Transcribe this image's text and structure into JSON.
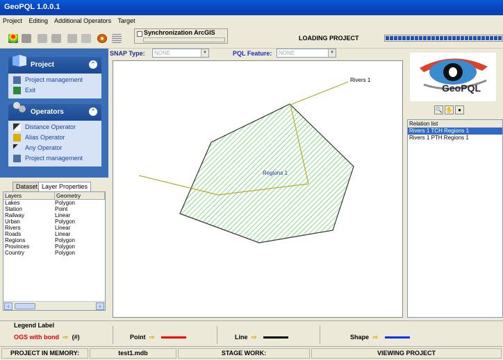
{
  "window": {
    "title": "GeoPQL 1.0.0.1"
  },
  "menu": [
    "Project",
    "Editing",
    "Additional Operators",
    "Target"
  ],
  "toolbar": {
    "sync_label": "Synchronization ArcGIS",
    "loading_label": "LOADING PROJECT",
    "icons": [
      "traffic-light-icon",
      "disk-icon",
      "edit-icon",
      "pen-icon",
      "pin-icon",
      "line-icon",
      "target-icon",
      "grid-icon"
    ]
  },
  "sidebar": {
    "project": {
      "title": "Project",
      "items": [
        {
          "label": "Project management",
          "icon": "project-icon"
        },
        {
          "label": "Exit",
          "icon": "exit-icon"
        }
      ]
    },
    "operators": {
      "title": "Operators",
      "items": [
        {
          "label": "Distance Operator",
          "icon": "distance-icon"
        },
        {
          "label": "Alias Operator",
          "icon": "alias-icon"
        },
        {
          "label": "Any Operator",
          "icon": "any-icon"
        },
        {
          "label": "Project management",
          "icon": "project-icon"
        }
      ]
    }
  },
  "tabs": [
    "Dataset",
    "Layer Properties"
  ],
  "layers": {
    "headers": [
      "Layers",
      "Geometry"
    ],
    "rows": [
      [
        "Lakes",
        "Polygon"
      ],
      [
        "Station",
        "Point"
      ],
      [
        "Railway",
        "Linear"
      ],
      [
        "Urban",
        "Polygon"
      ],
      [
        "Rivers",
        "Linear"
      ],
      [
        "Roads",
        "Linear"
      ],
      [
        "Regions",
        "Polygon"
      ],
      [
        "Provinces",
        "Polygon"
      ],
      [
        "Country",
        "Polygon"
      ]
    ]
  },
  "snap": {
    "label": "SNAP Type:",
    "value": "NONE"
  },
  "pql": {
    "label": "PQL Feature:",
    "value": "NONE"
  },
  "map": {
    "river_label": "Rivers 1",
    "region_label": "Regions 1",
    "colors": {
      "river": "#b8a830",
      "region_hatch": "#33cc33",
      "region_label": "#2233aa"
    }
  },
  "logo": {
    "text": "GeoPQL"
  },
  "relation_list": {
    "header": "Relation list",
    "items": [
      {
        "label": "Rivers 1 TCH Regions 1",
        "selected": true
      },
      {
        "label": "Rivers 1 PTH Regions 1",
        "selected": false
      }
    ]
  },
  "legend": {
    "title": "Legend Label",
    "ogs": "OGS with bond",
    "ogs_value": "(#)",
    "point": "Point",
    "line": "Line",
    "shape": "Shape",
    "colors": {
      "ogs": "#ee0000",
      "point": "#ff0000",
      "line": "#000000",
      "shape": "#0033ff"
    }
  },
  "status": {
    "memory_label": "PROJECT IN MEMORY:",
    "file": "test1.mdb",
    "stage_label": "STAGE WORK:",
    "stage_value": "VIEWING PROJECT"
  }
}
